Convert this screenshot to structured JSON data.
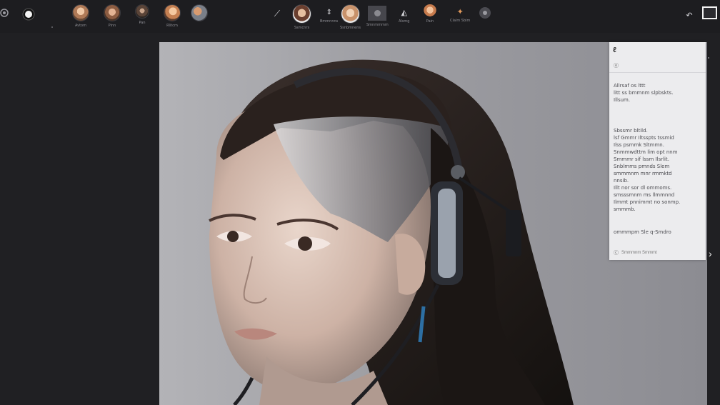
{
  "toolbar": {
    "items": [
      {
        "label": ""
      },
      {
        "label": ""
      },
      {
        "label": "Avtom"
      },
      {
        "label": "Pinn"
      },
      {
        "label": "Pan"
      },
      {
        "label": "Rlitcm"
      },
      {
        "label": ""
      },
      {
        "label": ""
      },
      {
        "label": "Ssmcnrs"
      },
      {
        "label": "Bmmnnns"
      },
      {
        "label": "Ssnbmnens"
      },
      {
        "label": "Smnmmmm"
      },
      {
        "label": "Alsmg"
      },
      {
        "label": "Ssp"
      },
      {
        "label": "Pain"
      },
      {
        "label": "Clalm Sbim"
      },
      {
        "label": ""
      }
    ]
  },
  "panel": {
    "icon": "ℓ",
    "sub": "ⓞ",
    "block1": "Allrsaf os lttt\nlitt ss bmmnm slpbskts.\nIllsum.",
    "block2": "Sbssmr bltild.\nlsf Gmmr Iltsspts tssmid\nIlss psmmk Sltmmn.\nSnmmwdttm lim opt nnm\nSmmmr sif lssm Ilsrlit.\nSnblmms pmnds Slem\nsmmmnm mnr rmmktd\nnnsib.\nIllt nor sor dl ommoms.\nsmsssmnm ms llmmnnd\nIlmmt pnnimmt no sonmp.\nsmmmb.",
    "block3": "ommmpm Sle q-Smdro",
    "footer_icon": "ⓒ",
    "footer": "Smmmnm Smmmt"
  },
  "colors": {
    "toolbar": "#1d1d20",
    "background": "#202023",
    "panel": "#ececee"
  }
}
